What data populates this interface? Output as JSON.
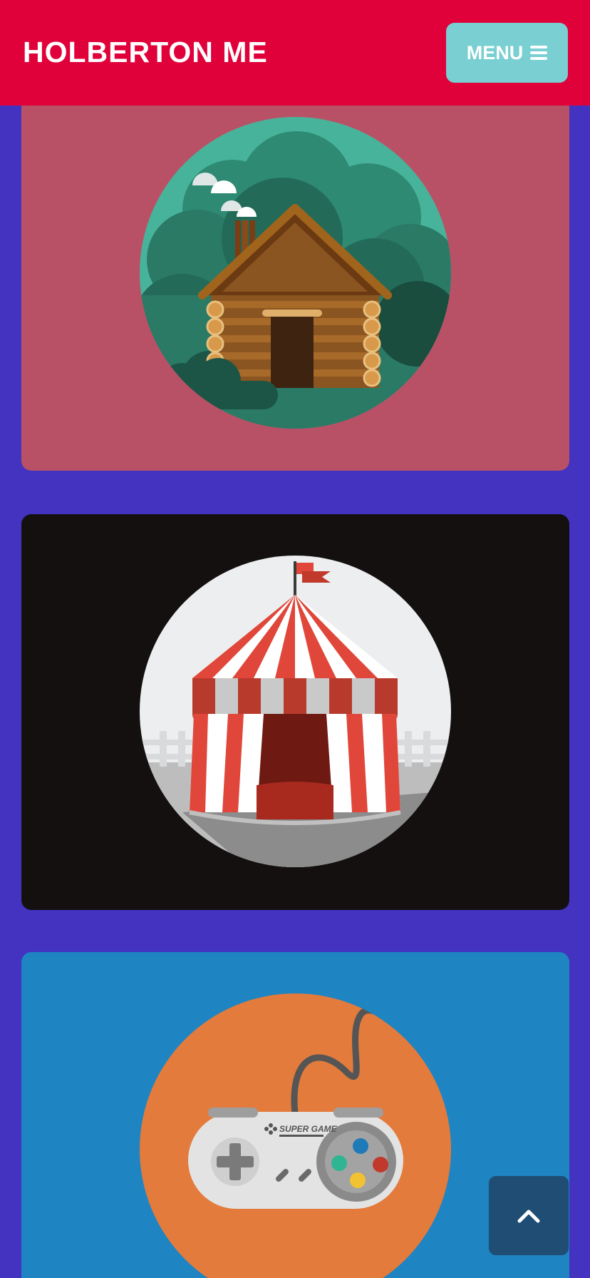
{
  "header": {
    "brand": "HOLBERTON ME",
    "menu_label": "MENU",
    "menu_icon": "hamburger-icon"
  },
  "cards": [
    {
      "illustration": "log-cabin-illustration",
      "background": "#b95166"
    },
    {
      "illustration": "circus-tent-illustration",
      "background": "#141010"
    },
    {
      "illustration": "game-controller-illustration",
      "background": "#1e84c2",
      "controller_text": "SUPER GAME"
    }
  ],
  "scroll_top": {
    "icon": "chevron-up-icon"
  },
  "colors": {
    "page_background": "#4333c0",
    "header": "#e0003a",
    "menu_button": "#79cfd1",
    "scroll_top_button": "#1f4d73"
  }
}
